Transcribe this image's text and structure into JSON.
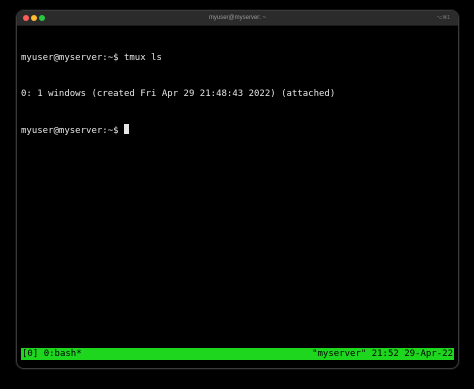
{
  "window": {
    "title": "myuser@myserver: ~",
    "shortcut": "⌥⌘1",
    "traffic_colors": {
      "close": "#ff5f57",
      "minimize": "#febc2e",
      "maximize": "#28c840"
    }
  },
  "terminal": {
    "lines": [
      "myuser@myserver:~$ tmux ls",
      "0: 1 windows (created Fri Apr 29 21:48:43 2022) (attached)",
      "myuser@myserver:~$ "
    ],
    "foreground": "#e6e6e6",
    "background": "#000000"
  },
  "tmux_status": {
    "session": "[0]",
    "window_list": "0:bash*",
    "host": "\"myserver\"",
    "time": "21:52",
    "date": "29-Apr-22",
    "background": "#1fd61f"
  }
}
